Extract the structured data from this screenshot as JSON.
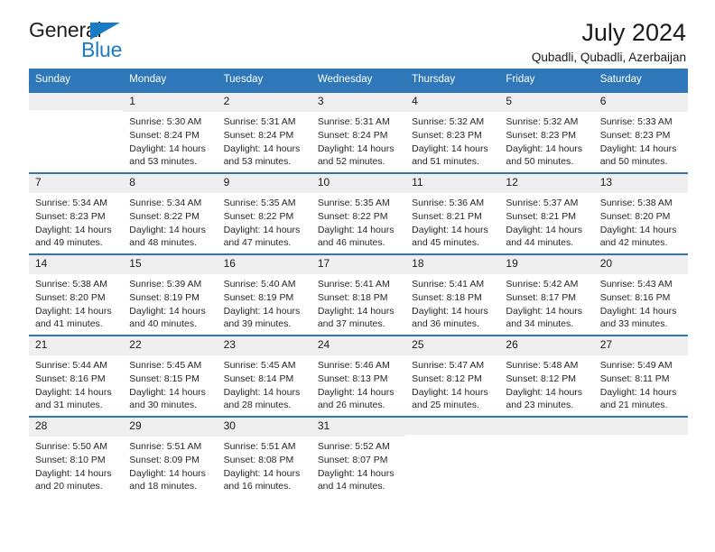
{
  "brand": {
    "name_part1": "General",
    "name_part2": "Blue",
    "accent_color": "#1b7ac4"
  },
  "header": {
    "title": "July 2024",
    "location": "Qubadli, Qubadli, Azerbaijan"
  },
  "colors": {
    "header_blue": "#2e77b8",
    "day_band_gray": "#efefef",
    "text": "#1a1a1a"
  },
  "weekdays": [
    "Sunday",
    "Monday",
    "Tuesday",
    "Wednesday",
    "Thursday",
    "Friday",
    "Saturday"
  ],
  "weeks": [
    [
      {
        "day": "",
        "sunrise": "",
        "sunset": "",
        "daylight_line1": "",
        "daylight_line2": ""
      },
      {
        "day": "1",
        "sunrise": "Sunrise: 5:30 AM",
        "sunset": "Sunset: 8:24 PM",
        "daylight_line1": "Daylight: 14 hours",
        "daylight_line2": "and 53 minutes."
      },
      {
        "day": "2",
        "sunrise": "Sunrise: 5:31 AM",
        "sunset": "Sunset: 8:24 PM",
        "daylight_line1": "Daylight: 14 hours",
        "daylight_line2": "and 53 minutes."
      },
      {
        "day": "3",
        "sunrise": "Sunrise: 5:31 AM",
        "sunset": "Sunset: 8:24 PM",
        "daylight_line1": "Daylight: 14 hours",
        "daylight_line2": "and 52 minutes."
      },
      {
        "day": "4",
        "sunrise": "Sunrise: 5:32 AM",
        "sunset": "Sunset: 8:23 PM",
        "daylight_line1": "Daylight: 14 hours",
        "daylight_line2": "and 51 minutes."
      },
      {
        "day": "5",
        "sunrise": "Sunrise: 5:32 AM",
        "sunset": "Sunset: 8:23 PM",
        "daylight_line1": "Daylight: 14 hours",
        "daylight_line2": "and 50 minutes."
      },
      {
        "day": "6",
        "sunrise": "Sunrise: 5:33 AM",
        "sunset": "Sunset: 8:23 PM",
        "daylight_line1": "Daylight: 14 hours",
        "daylight_line2": "and 50 minutes."
      }
    ],
    [
      {
        "day": "7",
        "sunrise": "Sunrise: 5:34 AM",
        "sunset": "Sunset: 8:23 PM",
        "daylight_line1": "Daylight: 14 hours",
        "daylight_line2": "and 49 minutes."
      },
      {
        "day": "8",
        "sunrise": "Sunrise: 5:34 AM",
        "sunset": "Sunset: 8:22 PM",
        "daylight_line1": "Daylight: 14 hours",
        "daylight_line2": "and 48 minutes."
      },
      {
        "day": "9",
        "sunrise": "Sunrise: 5:35 AM",
        "sunset": "Sunset: 8:22 PM",
        "daylight_line1": "Daylight: 14 hours",
        "daylight_line2": "and 47 minutes."
      },
      {
        "day": "10",
        "sunrise": "Sunrise: 5:35 AM",
        "sunset": "Sunset: 8:22 PM",
        "daylight_line1": "Daylight: 14 hours",
        "daylight_line2": "and 46 minutes."
      },
      {
        "day": "11",
        "sunrise": "Sunrise: 5:36 AM",
        "sunset": "Sunset: 8:21 PM",
        "daylight_line1": "Daylight: 14 hours",
        "daylight_line2": "and 45 minutes."
      },
      {
        "day": "12",
        "sunrise": "Sunrise: 5:37 AM",
        "sunset": "Sunset: 8:21 PM",
        "daylight_line1": "Daylight: 14 hours",
        "daylight_line2": "and 44 minutes."
      },
      {
        "day": "13",
        "sunrise": "Sunrise: 5:38 AM",
        "sunset": "Sunset: 8:20 PM",
        "daylight_line1": "Daylight: 14 hours",
        "daylight_line2": "and 42 minutes."
      }
    ],
    [
      {
        "day": "14",
        "sunrise": "Sunrise: 5:38 AM",
        "sunset": "Sunset: 8:20 PM",
        "daylight_line1": "Daylight: 14 hours",
        "daylight_line2": "and 41 minutes."
      },
      {
        "day": "15",
        "sunrise": "Sunrise: 5:39 AM",
        "sunset": "Sunset: 8:19 PM",
        "daylight_line1": "Daylight: 14 hours",
        "daylight_line2": "and 40 minutes."
      },
      {
        "day": "16",
        "sunrise": "Sunrise: 5:40 AM",
        "sunset": "Sunset: 8:19 PM",
        "daylight_line1": "Daylight: 14 hours",
        "daylight_line2": "and 39 minutes."
      },
      {
        "day": "17",
        "sunrise": "Sunrise: 5:41 AM",
        "sunset": "Sunset: 8:18 PM",
        "daylight_line1": "Daylight: 14 hours",
        "daylight_line2": "and 37 minutes."
      },
      {
        "day": "18",
        "sunrise": "Sunrise: 5:41 AM",
        "sunset": "Sunset: 8:18 PM",
        "daylight_line1": "Daylight: 14 hours",
        "daylight_line2": "and 36 minutes."
      },
      {
        "day": "19",
        "sunrise": "Sunrise: 5:42 AM",
        "sunset": "Sunset: 8:17 PM",
        "daylight_line1": "Daylight: 14 hours",
        "daylight_line2": "and 34 minutes."
      },
      {
        "day": "20",
        "sunrise": "Sunrise: 5:43 AM",
        "sunset": "Sunset: 8:16 PM",
        "daylight_line1": "Daylight: 14 hours",
        "daylight_line2": "and 33 minutes."
      }
    ],
    [
      {
        "day": "21",
        "sunrise": "Sunrise: 5:44 AM",
        "sunset": "Sunset: 8:16 PM",
        "daylight_line1": "Daylight: 14 hours",
        "daylight_line2": "and 31 minutes."
      },
      {
        "day": "22",
        "sunrise": "Sunrise: 5:45 AM",
        "sunset": "Sunset: 8:15 PM",
        "daylight_line1": "Daylight: 14 hours",
        "daylight_line2": "and 30 minutes."
      },
      {
        "day": "23",
        "sunrise": "Sunrise: 5:45 AM",
        "sunset": "Sunset: 8:14 PM",
        "daylight_line1": "Daylight: 14 hours",
        "daylight_line2": "and 28 minutes."
      },
      {
        "day": "24",
        "sunrise": "Sunrise: 5:46 AM",
        "sunset": "Sunset: 8:13 PM",
        "daylight_line1": "Daylight: 14 hours",
        "daylight_line2": "and 26 minutes."
      },
      {
        "day": "25",
        "sunrise": "Sunrise: 5:47 AM",
        "sunset": "Sunset: 8:12 PM",
        "daylight_line1": "Daylight: 14 hours",
        "daylight_line2": "and 25 minutes."
      },
      {
        "day": "26",
        "sunrise": "Sunrise: 5:48 AM",
        "sunset": "Sunset: 8:12 PM",
        "daylight_line1": "Daylight: 14 hours",
        "daylight_line2": "and 23 minutes."
      },
      {
        "day": "27",
        "sunrise": "Sunrise: 5:49 AM",
        "sunset": "Sunset: 8:11 PM",
        "daylight_line1": "Daylight: 14 hours",
        "daylight_line2": "and 21 minutes."
      }
    ],
    [
      {
        "day": "28",
        "sunrise": "Sunrise: 5:50 AM",
        "sunset": "Sunset: 8:10 PM",
        "daylight_line1": "Daylight: 14 hours",
        "daylight_line2": "and 20 minutes."
      },
      {
        "day": "29",
        "sunrise": "Sunrise: 5:51 AM",
        "sunset": "Sunset: 8:09 PM",
        "daylight_line1": "Daylight: 14 hours",
        "daylight_line2": "and 18 minutes."
      },
      {
        "day": "30",
        "sunrise": "Sunrise: 5:51 AM",
        "sunset": "Sunset: 8:08 PM",
        "daylight_line1": "Daylight: 14 hours",
        "daylight_line2": "and 16 minutes."
      },
      {
        "day": "31",
        "sunrise": "Sunrise: 5:52 AM",
        "sunset": "Sunset: 8:07 PM",
        "daylight_line1": "Daylight: 14 hours",
        "daylight_line2": "and 14 minutes."
      },
      {
        "day": "",
        "sunrise": "",
        "sunset": "",
        "daylight_line1": "",
        "daylight_line2": ""
      },
      {
        "day": "",
        "sunrise": "",
        "sunset": "",
        "daylight_line1": "",
        "daylight_line2": ""
      },
      {
        "day": "",
        "sunrise": "",
        "sunset": "",
        "daylight_line1": "",
        "daylight_line2": ""
      }
    ]
  ]
}
